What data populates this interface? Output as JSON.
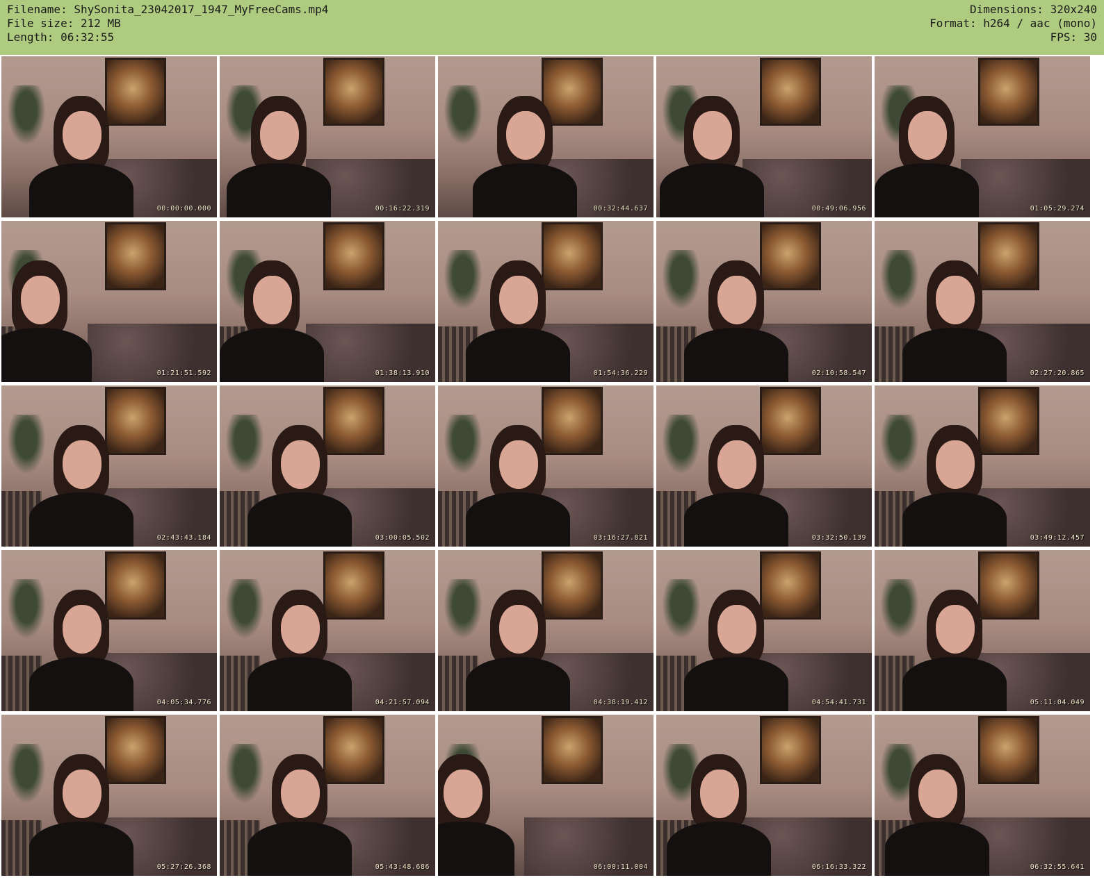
{
  "header": {
    "filename": "Filename: ShySonita_23042017_1947_MyFreeCams.mp4",
    "filesize": "File size: 212 MB",
    "length": "Length: 06:32:55",
    "dimensions": "Dimensions: 320x240",
    "format": "Format: h264 / aac (mono)",
    "fps": "FPS: 30"
  },
  "thumbnails": [
    {
      "timestamp": "00:00:00.000"
    },
    {
      "timestamp": "00:16:22.319"
    },
    {
      "timestamp": "00:32:44.637"
    },
    {
      "timestamp": "00:49:06.956"
    },
    {
      "timestamp": "01:05:29.274"
    },
    {
      "timestamp": "01:21:51.592"
    },
    {
      "timestamp": "01:38:13.910"
    },
    {
      "timestamp": "01:54:36.229"
    },
    {
      "timestamp": "02:10:58.547"
    },
    {
      "timestamp": "02:27:20.865"
    },
    {
      "timestamp": "02:43:43.184"
    },
    {
      "timestamp": "03:00:05.502"
    },
    {
      "timestamp": "03:16:27.821"
    },
    {
      "timestamp": "03:32:50.139"
    },
    {
      "timestamp": "03:49:12.457"
    },
    {
      "timestamp": "04:05:34.776"
    },
    {
      "timestamp": "04:21:57.094"
    },
    {
      "timestamp": "04:38:19.412"
    },
    {
      "timestamp": "04:54:41.731"
    },
    {
      "timestamp": "05:11:04.049"
    },
    {
      "timestamp": "05:27:26.368"
    },
    {
      "timestamp": "05:43:48.686"
    },
    {
      "timestamp": "06:00:11.004"
    },
    {
      "timestamp": "06:16:33.322"
    },
    {
      "timestamp": "06:32:55.641"
    }
  ]
}
